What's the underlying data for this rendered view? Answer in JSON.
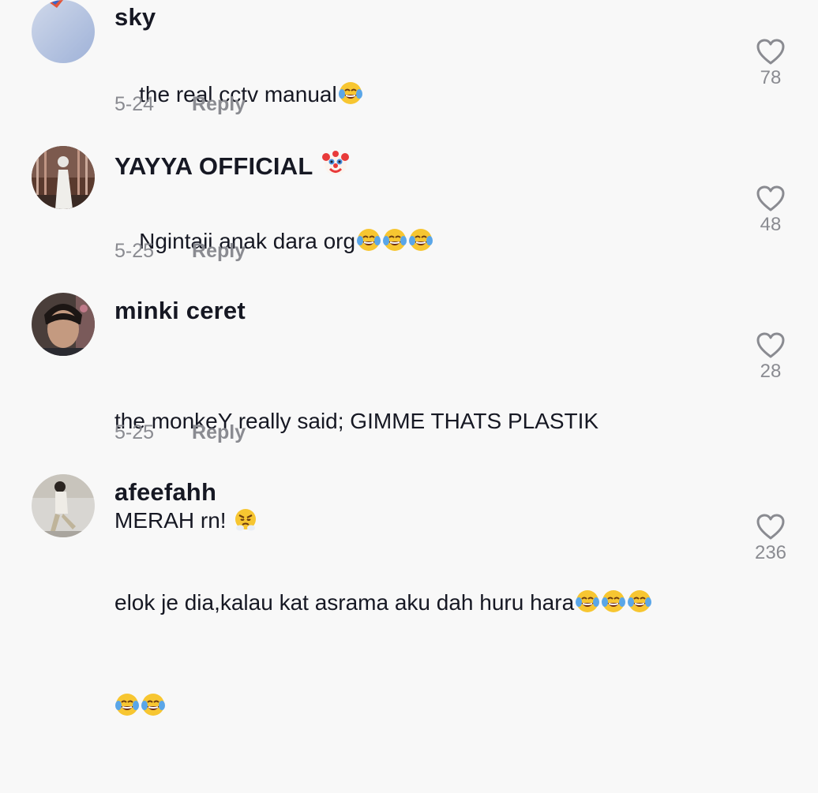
{
  "comments": [
    {
      "username": "sky",
      "text": "the real cctv manual",
      "emoji": [
        "face-with-tears-of-joy"
      ],
      "date": "5-24",
      "reply_label": "Reply",
      "likes": "78"
    },
    {
      "username": "YAYYA OFFICIAL",
      "username_badge": "clown-face",
      "text": "Ngintaii anak dara org",
      "emoji": [
        "face-with-tears-of-joy",
        "face-with-tears-of-joy",
        "face-with-tears-of-joy"
      ],
      "date": "5-25",
      "reply_label": "Reply",
      "likes": "48"
    },
    {
      "username": "minki ceret",
      "text_line1": "the monkeY really said; GIMME THATS PLASTIK",
      "text_line2": "MERAH rn! ",
      "emoji": [
        "face-with-steam-from-nose"
      ],
      "date": "5-25",
      "reply_label": "Reply",
      "likes": "28"
    },
    {
      "username": "afeefahh",
      "text": "elok je dia,kalau kat asrama aku dah huru hara",
      "emoji": [
        "face-with-tears-of-joy",
        "face-with-tears-of-joy",
        "face-with-tears-of-joy",
        "face-with-tears-of-joy",
        "face-with-tears-of-joy"
      ],
      "likes": "236"
    }
  ],
  "colors": {
    "background": "#f8f8f8",
    "username": "#161823",
    "muted": "#8a8b91"
  }
}
